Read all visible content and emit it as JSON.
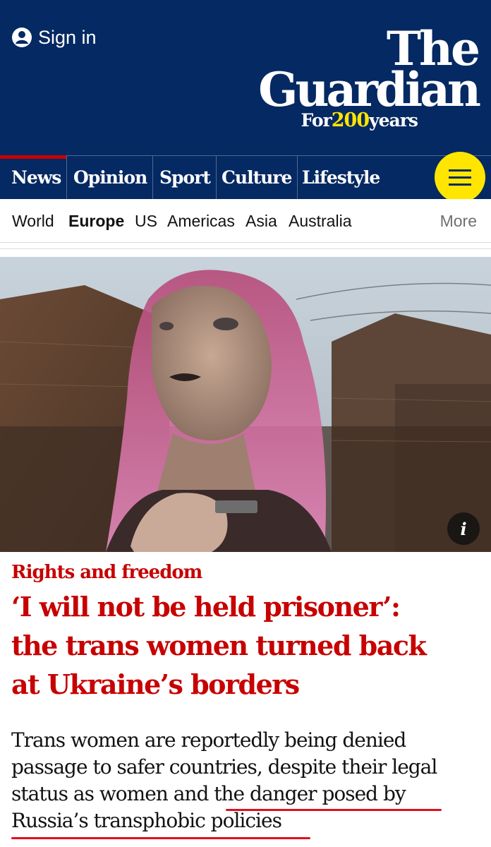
{
  "header": {
    "signin_label": "Sign in",
    "logo_line1": "The",
    "logo_line2": "Guardian",
    "logo_tag_prefix": "For",
    "logo_tag_number": "200",
    "logo_tag_suffix": "years"
  },
  "pillars": [
    "News",
    "Opinion",
    "Sport",
    "Culture",
    "Lifestyle"
  ],
  "active_pillar": "News",
  "menu_icon": "hamburger-menu-icon",
  "subnav": {
    "items": [
      "World",
      "Europe",
      "US",
      "Americas",
      "Asia",
      "Australia"
    ],
    "active": "Europe",
    "more_label": "More"
  },
  "photo": {
    "info_label": "i"
  },
  "article": {
    "kicker": "Rights and freedom",
    "headline_lines": [
      "‘I will not be held prisoner’:",
      "the trans women turned back",
      "at Ukraine’s borders"
    ],
    "standfirst_lines": [
      "Trans women are reportedly being denied",
      "passage to safer countries, despite their legal",
      "status as women and the danger posed by",
      "Russia’s transphobic policies"
    ]
  },
  "colors": {
    "brand_blue": "#052962",
    "brand_yellow": "#ffe500",
    "news_red": "#c70000",
    "annotation_red": "#e01020"
  }
}
